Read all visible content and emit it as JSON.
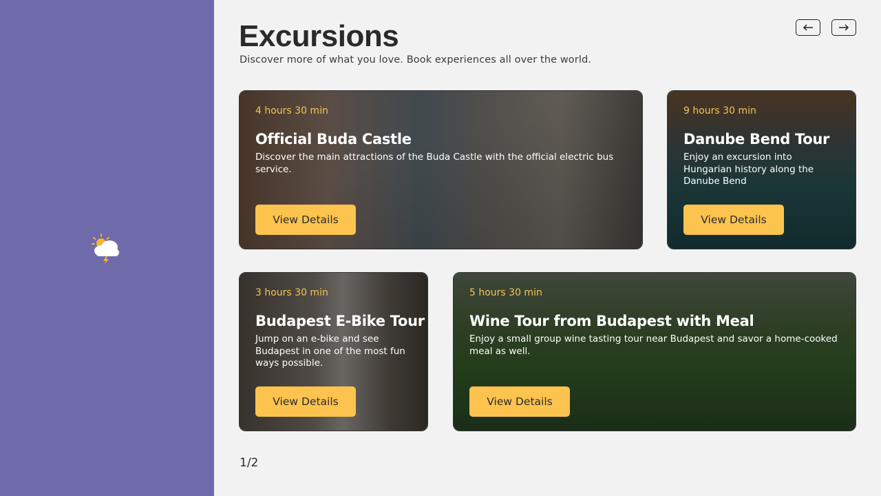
{
  "header": {
    "title": "Excursions",
    "subtitle": "Discover more of what you love. Book experiences all over the world."
  },
  "nav": {
    "prev_icon": "arrow-left-icon",
    "next_icon": "arrow-right-icon"
  },
  "sidebar": {
    "weather_icon": "sun-cloud-lightning-icon"
  },
  "cards": [
    {
      "duration": "4 hours 30 min",
      "title": "Official Buda Castle",
      "description": "Discover the main attractions of the Buda Castle with the official electric bus service.",
      "button": "View Details"
    },
    {
      "duration": "9 hours 30 min",
      "title": "Danube Bend Tour",
      "description": "Enjoy an excursion into Hungarian history along the Danube Bend",
      "button": "View Details"
    },
    {
      "duration": "3 hours 30 min",
      "title": "Budapest E-Bike Tour",
      "description": "Jump on an e-bike and see Budapest in one of the most fun ways possible.",
      "button": "View Details"
    },
    {
      "duration": "5 hours 30 min",
      "title": "Wine Tour from Budapest with Meal",
      "description": "Enjoy a small group wine tasting tour near Budapest and savor a home-cooked meal as well.",
      "button": "View Details"
    }
  ],
  "pagination": {
    "label": "1/2"
  },
  "colors": {
    "sidebar": "#6f6aaa",
    "accent": "#fdc34f",
    "duration_text": "#f6c453",
    "background": "#f1f2f1"
  }
}
